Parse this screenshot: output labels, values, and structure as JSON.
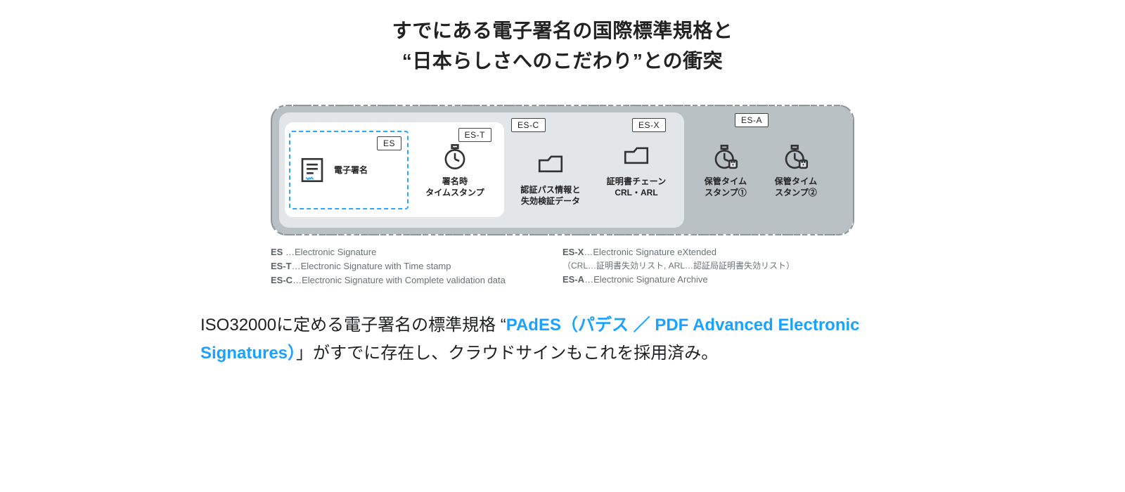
{
  "title": {
    "line1": "すでにある電子署名の国際標準規格と",
    "line2": "“日本らしさへのこだわり”との衝突"
  },
  "diagram": {
    "es": {
      "badge": "ES",
      "label": "電子署名"
    },
    "est": {
      "badge": "ES-T",
      "label1": "署名時",
      "label2": "タイムスタンプ"
    },
    "esc": {
      "badge": "ES-C",
      "label1": "認証パス情報と",
      "label2": "失効検証データ"
    },
    "esx": {
      "badge": "ES-X",
      "label1": "証明書チェーン",
      "label2": "CRL・ARL"
    },
    "esa": {
      "badge": "ES-A"
    },
    "esa1": {
      "label1": "保管タイム",
      "label2": "スタンプ①"
    },
    "esa2": {
      "label1": "保管タイム",
      "label2": "スタンプ②"
    }
  },
  "legend": {
    "left": {
      "l1k": "ES",
      "l1v": " …Electronic Signature",
      "l2k": "ES-T",
      "l2v": "…Electronic Signature with Time stamp",
      "l3k": "ES-C",
      "l3v": "…Electronic Signature with Complete validation data"
    },
    "right": {
      "l1k": "ES-X",
      "l1v": "…Electronic Signature eXtended",
      "l1s": "（CRL…証明書失効リスト, ARL…認証局証明書失効リスト）",
      "l2k": "ES-A",
      "l2v": "…Electronic Signature Archive"
    }
  },
  "footer": {
    "p1": "ISO32000に定める電子署名の標準規格 “",
    "accent": "PAdES（パデス ／ PDF Advanced Electronic Signatures）",
    "p2": "」がすでに存在し、クラウドサインもこれを採用済み。"
  }
}
